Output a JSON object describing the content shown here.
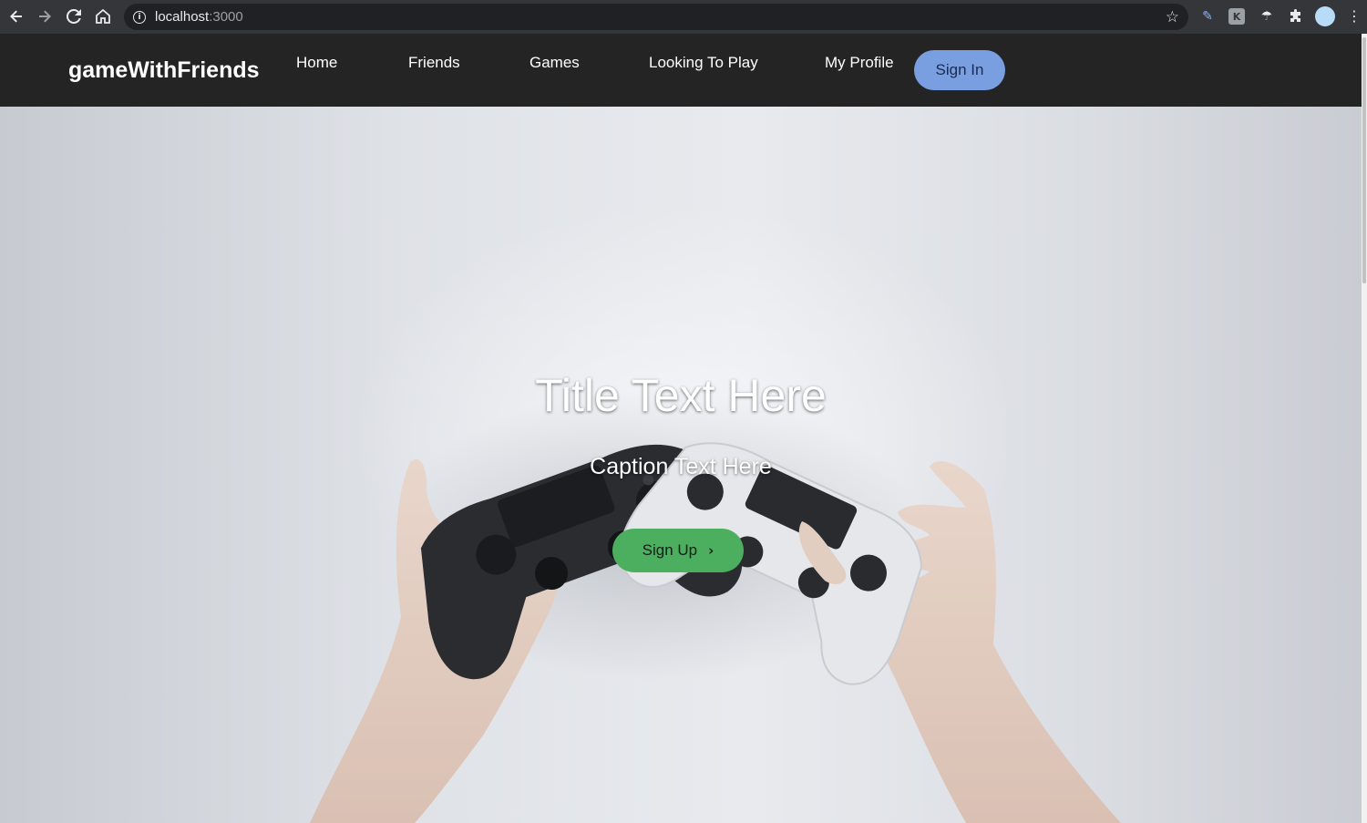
{
  "browser": {
    "url_host": "localhost",
    "url_port": ":3000",
    "icons": {
      "back": "back-arrow-icon",
      "forward": "forward-arrow-icon",
      "reload": "reload-icon",
      "home": "home-icon",
      "info": "site-info-icon",
      "bookmark": "star-icon",
      "menu": "kebab-menu-icon"
    }
  },
  "navbar": {
    "brand": "gameWithFriends",
    "links": [
      "Home",
      "Friends",
      "Games",
      "Looking To Play",
      "My Profile"
    ],
    "signin_label": "Sign In"
  },
  "hero": {
    "title": "Title Text Here",
    "caption": "Caption Text Here",
    "cta_label": "Sign Up"
  },
  "colors": {
    "navbar_bg": "#242424",
    "signin_bg": "#7a9fe0",
    "cta_bg": "#4caf5f"
  }
}
